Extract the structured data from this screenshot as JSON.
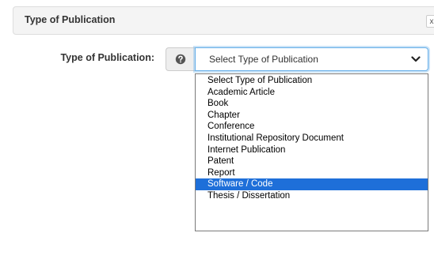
{
  "panel": {
    "title": "Type of Publication",
    "close_glyph": "x"
  },
  "field": {
    "label": "Type of Publication:",
    "help_icon": "help-circle-icon",
    "selected_value": "Select Type of Publication"
  },
  "dropdown": {
    "options": [
      "Select Type of Publication",
      "Academic Article",
      "Book",
      "Chapter",
      "Conference",
      "Institutional Repository Document",
      "Internet Publication",
      "Patent",
      "Report",
      "Software / Code",
      "Thesis / Dissertation"
    ],
    "highlighted_option": "Software / Code"
  },
  "colors": {
    "highlight": "#1e6fd9",
    "focus_border": "#66afe9",
    "header_bg": "#f4f4f4"
  }
}
